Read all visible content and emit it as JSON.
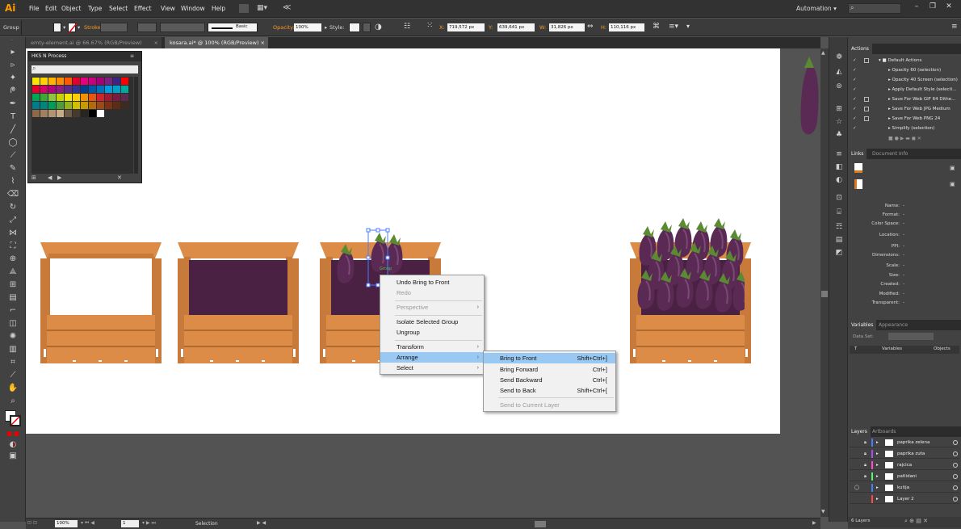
{
  "menubar": {
    "logo": "Ai",
    "items": [
      "File",
      "Edit",
      "Object",
      "Type",
      "Select",
      "Effect",
      "View",
      "Window",
      "Help"
    ],
    "workspace": "Automation",
    "win_minimize": "–",
    "win_restore": "❐",
    "win_close": "✕"
  },
  "control_bar": {
    "selection": "Group",
    "stroke_label": "Stroke:",
    "brush_label": "Basic",
    "opacity_label": "Opacity:",
    "opacity_value": "100%",
    "style_label": "Style:",
    "x_label": "X:",
    "x_value": "719,572 px",
    "y_label": "Y:",
    "y_value": "639,641 px",
    "w_label": "W:",
    "w_value": "31,826 px",
    "h_label": "H:",
    "h_value": "110,116 px"
  },
  "doc_tabs": [
    {
      "label": "emty-element.ai @ 66.67% (RGB/Preview)",
      "close": "×"
    },
    {
      "label": "kosara.ai* @ 100% (RGB/Preview)",
      "close": "×"
    }
  ],
  "swatch_panel": {
    "title": "HKS N Process",
    "colors": [
      [
        "#f7e400",
        "#ffd200",
        "#ffb400",
        "#ff8c00",
        "#ff5a00",
        "#e4002b",
        "#e6007e",
        "#c8007d",
        "#a3007a",
        "#7a2182",
        "#3d2484",
        "#ff0000"
      ],
      [
        "#e5002c",
        "#d6006a",
        "#b3007c",
        "#8a1c84",
        "#5a2a8a",
        "#2c3590",
        "#003d8f",
        "#0057a8",
        "#0072bc",
        "#009ee0",
        "#00a0c6",
        "#00a99d"
      ],
      [
        "#00a651",
        "#3aaa35",
        "#8cc63e",
        "#c5d300",
        "#f3e600",
        "#ffcc00",
        "#f39200",
        "#e85511",
        "#d2232a",
        "#9e1b32",
        "#7a1c3e",
        "#5b2a4c"
      ],
      [
        "#007c8a",
        "#00847b",
        "#009c5b",
        "#4c9f38",
        "#93b21f",
        "#d0c100",
        "#c79a00",
        "#b46b0e",
        "#9c4a1a",
        "#7d3215",
        "#5c2c17",
        "#3e2a1e"
      ],
      [
        "#8a6a4a",
        "#a08060",
        "#b39470",
        "#c9ab88",
        "#6e5a46",
        "#463a2f",
        "#2a2420",
        "#000000",
        "#ffffff"
      ]
    ],
    "footer_icons": [
      "library-icon",
      "prev-icon",
      "next-icon",
      "tools-icon"
    ]
  },
  "canvas": {
    "context_label": "Group"
  },
  "context_menu": {
    "items": [
      {
        "label": "Undo Bring to Front",
        "disabled": false
      },
      {
        "label": "Redo",
        "disabled": true
      },
      {
        "label": "Perspective",
        "disabled": true,
        "submenu": true
      },
      {
        "label": "Isolate Selected Group",
        "disabled": false
      },
      {
        "label": "Ungroup",
        "disabled": false
      },
      {
        "label": "Transform",
        "disabled": false,
        "submenu": true
      },
      {
        "label": "Arrange",
        "disabled": false,
        "submenu": true,
        "highlighted": true
      },
      {
        "label": "Select",
        "disabled": false,
        "submenu": true
      }
    ],
    "arrow": "›"
  },
  "arrange_menu": {
    "items": [
      {
        "label": "Bring to Front",
        "shortcut": "Shift+Ctrl+]",
        "highlighted": true
      },
      {
        "label": "Bring Forward",
        "shortcut": "Ctrl+]"
      },
      {
        "label": "Send Backward",
        "shortcut": "Ctrl+["
      },
      {
        "label": "Send to Back",
        "shortcut": "Shift+Ctrl+["
      },
      {
        "label": "Send to Current Layer",
        "shortcut": "",
        "disabled": true
      }
    ]
  },
  "actions_panel": {
    "tab": "Actions",
    "rows": [
      {
        "label": "Default Actions",
        "folder": true
      },
      {
        "label": "Opacity 60 (selection)"
      },
      {
        "label": "Opacity 40 Screen (selection)"
      },
      {
        "label": "Apply Default Style (selecti..."
      },
      {
        "label": "Save For Web GIF 64 Dithe..."
      },
      {
        "label": "Save For Web JPG Medium"
      },
      {
        "label": "Save For Web PNG 24"
      },
      {
        "label": "Simplify (selection)"
      }
    ]
  },
  "links_panel": {
    "tabs": [
      "Links",
      "Document Info"
    ],
    "fields": [
      "Name:",
      "Format:",
      "Color Space:",
      "Location:",
      "PPI:",
      "Dimensions:",
      "Scale:",
      "Size:",
      "Created:",
      "Modified:",
      "Transparent:"
    ],
    "empty_value": "-"
  },
  "variables_panel": {
    "tabs": [
      "Variables",
      "Appearance"
    ],
    "data_set_label": "Data Set:",
    "col_variables": "Variables",
    "col_objects": "Objects",
    "col_t": "T"
  },
  "layers_panel": {
    "tabs": [
      "Layers",
      "Artboards"
    ],
    "layers": [
      {
        "name": "paprika zelena",
        "color": "#4a7cff"
      },
      {
        "name": "paprika zuta",
        "color": "#b04aff"
      },
      {
        "name": "rajcica",
        "color": "#ff4ad8"
      },
      {
        "name": "patlidani",
        "color": "#4aff6a"
      },
      {
        "name": "kutija",
        "color": "#4a7cff"
      },
      {
        "name": "Layer 2",
        "color": "#ff4a4a"
      }
    ],
    "count": "6 Layers"
  },
  "status_bar": {
    "zoom": "100%",
    "page": "1",
    "tool": "Selection"
  },
  "colors": {
    "crate_wood": "#dc8c46",
    "crate_wood_dark": "#c87a3a",
    "crate_inner": "#4a2143",
    "eggplant": "#5a2a55",
    "eggplant_light": "#7a4a75",
    "stem": "#5a8a32",
    "accent": "#ff9a00",
    "selection_blue": "#4a7cff"
  }
}
